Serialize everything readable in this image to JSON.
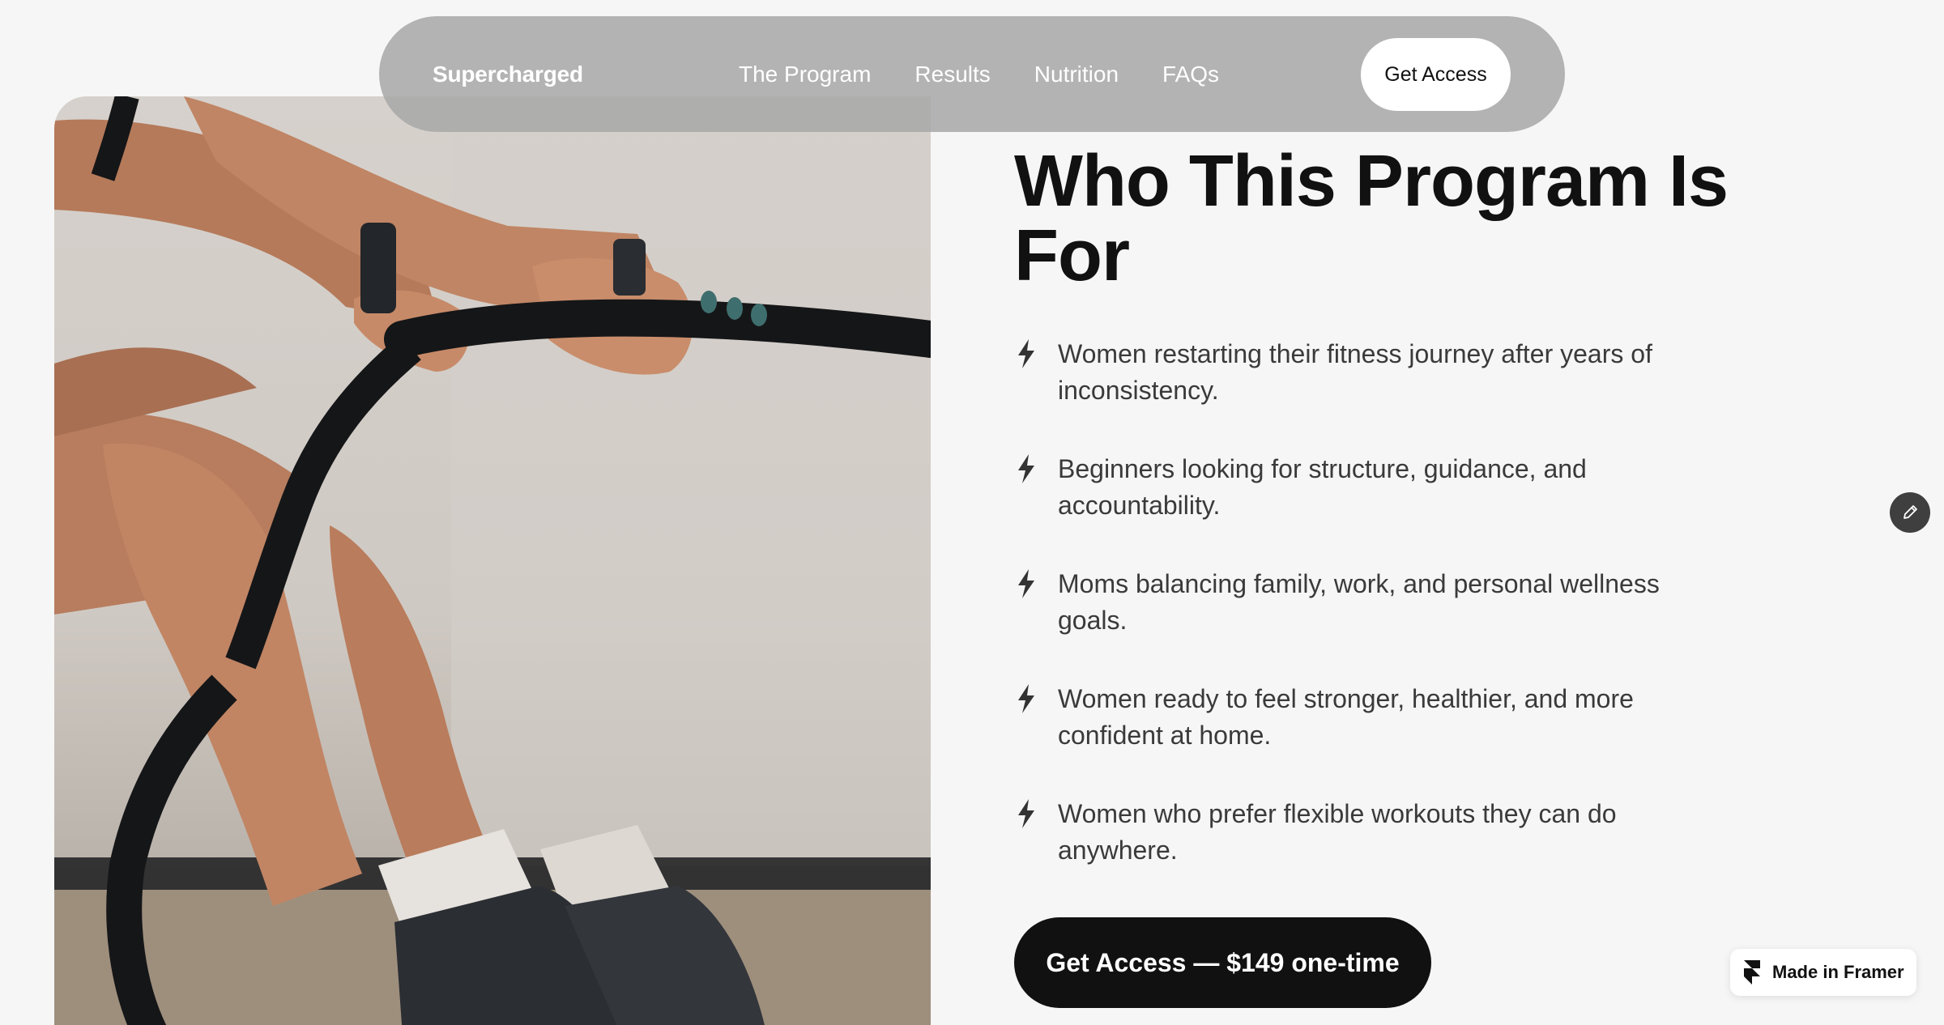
{
  "nav": {
    "brand": "Supercharged",
    "links": [
      "The Program",
      "Results",
      "Nutrition",
      "FAQs"
    ],
    "cta": "Get Access"
  },
  "section": {
    "title": "Who This Program Is For",
    "items": [
      "Women restarting their fitness journey after years of inconsistency.",
      "Beginners looking for structure, guidance, and accountability.",
      "Moms balancing family, work, and personal wellness goals.",
      "Women ready to feel stronger, healthier, and more confident at home.",
      "Women who prefer flexible workouts they can do anywhere."
    ],
    "cta": "Get Access — $149 one-time"
  },
  "badge": {
    "label": "Made in Framer"
  },
  "icons": {
    "list_bullet": "bolt-icon",
    "edit": "pencil-icon",
    "framer": "framer-logo-icon"
  },
  "colors": {
    "background": "#f6f6f6",
    "navbar": "#a8a8a8",
    "primary_button": "#111111",
    "text": "#3a3a3a"
  }
}
